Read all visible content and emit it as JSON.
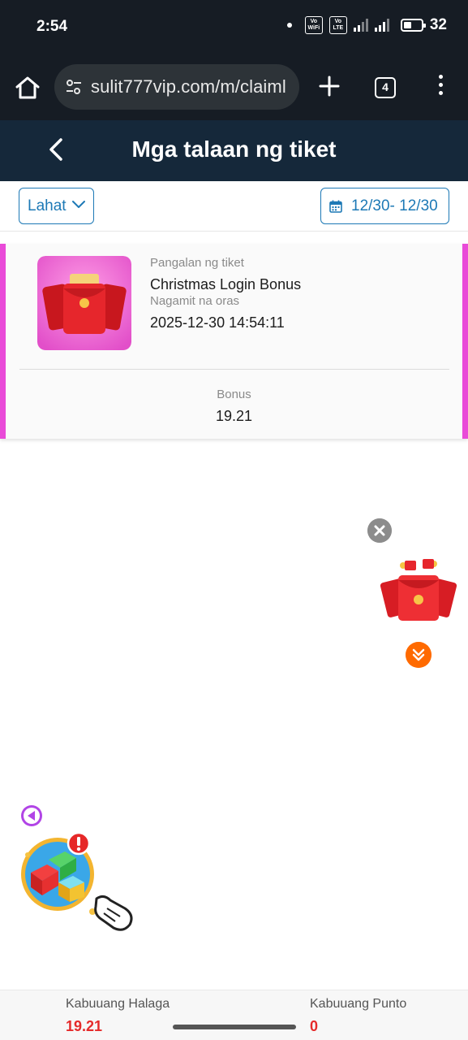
{
  "status_bar": {
    "time": "2:54",
    "sim1_badge": "Vo WiFi",
    "sim1_line1": "Vo",
    "sim1_line2": "WiFi",
    "sim1_index": "1",
    "sim2_badge": "Vo LTE",
    "sim2_line1": "Vo",
    "sim2_line2": "LTE",
    "sim2_index": "2",
    "battery": "32"
  },
  "browser": {
    "url": "sulit777vip.com/m/claiml",
    "tab_count": "4"
  },
  "header": {
    "title": "Mga talaan ng tiket"
  },
  "filters": {
    "type_label": "Lahat",
    "date_range": "12/30- 12/30"
  },
  "ticket": {
    "name_label": "Pangalan ng tiket",
    "name": "Christmas Login Bonus",
    "time_label": "Nagamit na oras",
    "time": "2025-12-30 14:54:11",
    "bonus_label": "Bonus",
    "bonus": "19.21"
  },
  "summary": {
    "total_amount_label": "Kabuuang Halaga",
    "total_amount": "19.21",
    "total_points_label": "Kabuuang Punto",
    "total_points": "0"
  },
  "colors": {
    "header_bg": "#15283a",
    "accent_blue": "#1d79b6",
    "stripe_pink": "#e94ad8",
    "value_red": "#e52a2a"
  },
  "icons": {
    "home": "home-icon",
    "site_settings": "tune-icon",
    "new_tab": "plus-icon",
    "menu": "more-vertical-icon",
    "back": "chevron-left-icon",
    "dropdown": "chevron-down-icon",
    "calendar": "calendar-icon",
    "close": "close-icon",
    "expand": "double-chevron-down-icon"
  }
}
